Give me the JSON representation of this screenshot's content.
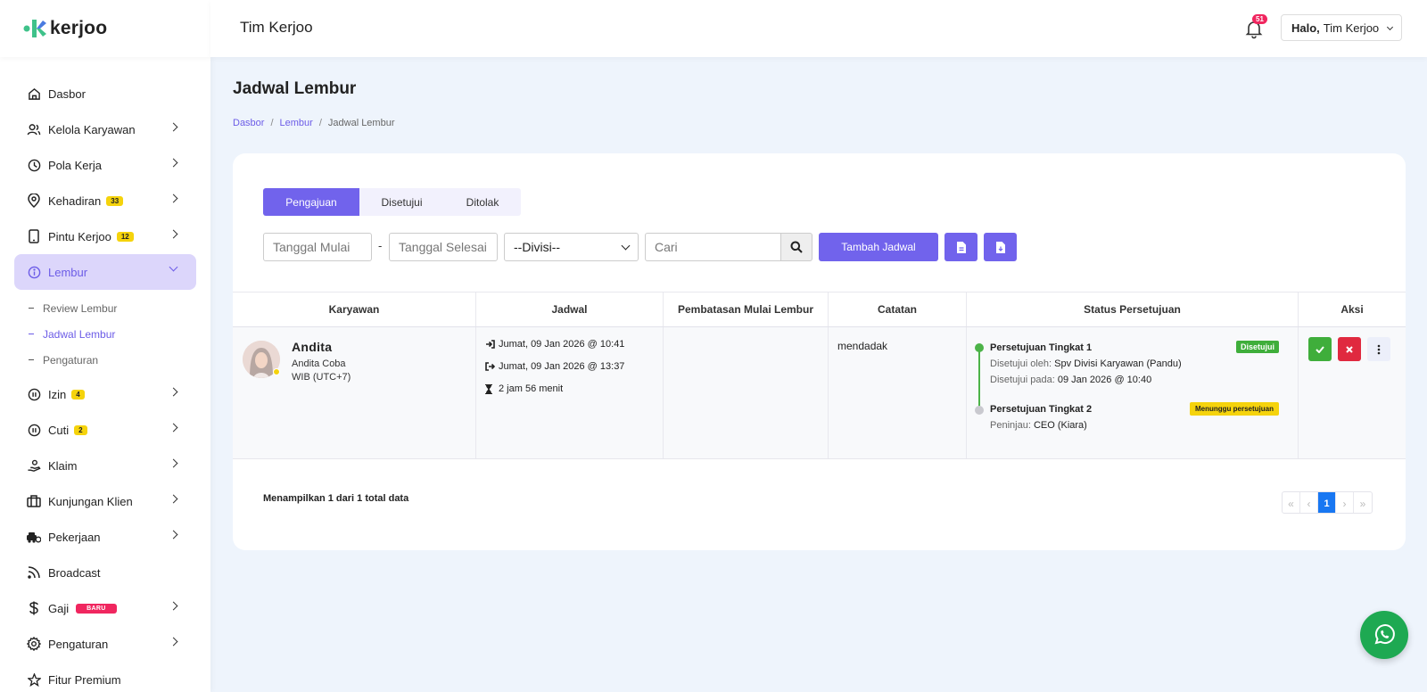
{
  "brand": {
    "name": "kerjoo"
  },
  "header": {
    "title": "Tim Kerjoo",
    "notif_count": "51",
    "greeting": "Halo,",
    "user_name": "Tim Kerjoo"
  },
  "sidebar": {
    "items": [
      {
        "label": "Dasbor"
      },
      {
        "label": "Kelola Karyawan"
      },
      {
        "label": "Pola Kerja"
      },
      {
        "label": "Kehadiran",
        "badge": "33"
      },
      {
        "label": "Pintu Kerjoo",
        "badge": "12"
      },
      {
        "label": "Lembur"
      },
      {
        "label": "Izin",
        "badge": "4"
      },
      {
        "label": "Cuti",
        "badge": "2"
      },
      {
        "label": "Klaim"
      },
      {
        "label": "Kunjungan Klien"
      },
      {
        "label": "Pekerjaan"
      },
      {
        "label": "Broadcast"
      },
      {
        "label": "Gaji",
        "badge": "BARU"
      },
      {
        "label": "Pengaturan"
      },
      {
        "label": "Fitur Premium"
      }
    ],
    "lembur_sub": [
      "Review Lembur",
      "Jadwal Lembur",
      "Pengaturan"
    ]
  },
  "page": {
    "title": "Jadwal Lembur",
    "breadcrumb": [
      "Dasbor",
      "Lembur",
      "Jadwal Lembur"
    ],
    "separator": "/"
  },
  "tabs": [
    "Pengajuan",
    "Disetujui",
    "Ditolak"
  ],
  "filters": {
    "start_placeholder": "Tanggal Mulai",
    "dash": "-",
    "end_placeholder": "Tanggal Selesai",
    "division": "--Divisi--",
    "search_placeholder": "Cari",
    "add_label": "Tambah Jadwal"
  },
  "table": {
    "headers": [
      "Karyawan",
      "Jadwal",
      "Pembatasan Mulai Lembur",
      "Catatan",
      "Status Persetujuan",
      "Aksi"
    ],
    "row": {
      "name": "Andita",
      "fullname": "Andita Coba",
      "timezone": "WIB (UTC+7)",
      "start": "Jumat, 09 Jan 2026 @ 10:41",
      "end": "Jumat, 09 Jan 2026 @ 13:37",
      "duration": "2 jam 56 menit",
      "limit": "",
      "note": "mendadak",
      "approval1": {
        "title": "Persetujuan Tingkat 1",
        "badge": "Disetujui",
        "by_label": "Disetujui oleh:",
        "by_value": "Spv Divisi Karyawan (Pandu)",
        "at_label": "Disetujui pada:",
        "at_value": "09 Jan 2026 @ 10:40"
      },
      "approval2": {
        "title": "Persetujuan Tingkat 2",
        "badge": "Menunggu persetujuan",
        "reviewer_label": "Peninjau:",
        "reviewer_value": "CEO (Kiara)"
      }
    }
  },
  "summary": "Menampilkan 1 dari 1 total data",
  "pagination": {
    "first": "«",
    "prev": "‹",
    "current": "1",
    "next": "›",
    "last": "»"
  },
  "colors": {
    "accent": "#7163ec",
    "success": "#3fae3b",
    "danger": "#e0293f",
    "warning": "#f5d30c",
    "whatsapp": "#1ea952"
  }
}
